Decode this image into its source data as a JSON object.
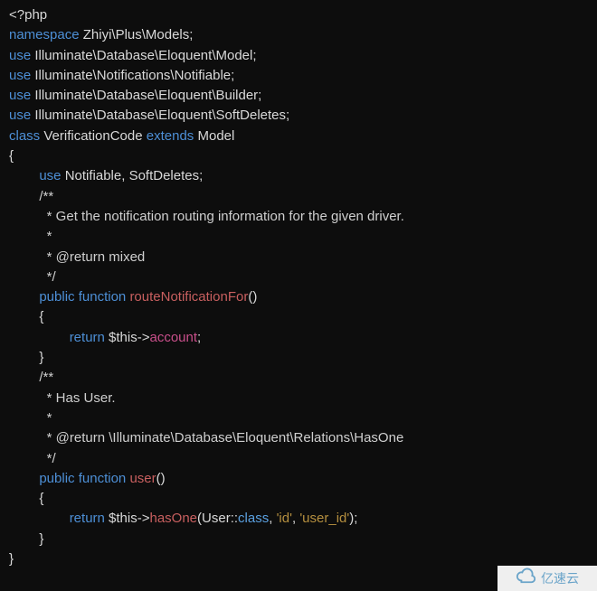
{
  "l0_open": "<?php",
  "l1_kw": "namespace",
  "l1_rest": " Zhiyi\\Plus\\Models;",
  "l2_kw": "use",
  "l2_rest": " Illuminate\\Database\\Eloquent\\Model;",
  "l3_kw": "use",
  "l3_rest": " Illuminate\\Notifications\\Notifiable;",
  "l4_kw": "use",
  "l4_rest": " Illuminate\\Database\\Eloquent\\Builder;",
  "l5_kw": "use",
  "l5_rest": " Illuminate\\Database\\Eloquent\\SoftDeletes;",
  "l6_kw1": "class",
  "l6_name": " VerificationCode ",
  "l6_kw2": "extends",
  "l6_rest": " Model",
  "l7": "{",
  "l8_pad": "        ",
  "l8_kw": "use",
  "l8_rest": " Notifiable, SoftDeletes;",
  "l9": "        /**",
  "l10": "          * Get the notification routing information for the given driver.",
  "l11": "          *",
  "l12": "          * @return mixed",
  "l13": "          */",
  "l14_pad": "        ",
  "l14_kw1": "public",
  "l14_sp1": " ",
  "l14_kw2": "function",
  "l14_sp2": " ",
  "l14_fn": "routeNotificationFor",
  "l14_rest": "()",
  "l15": "        {",
  "l16_pad": "                ",
  "l16_kw": "return",
  "l16_mid": " $this->",
  "l16_mem": "account",
  "l16_end": ";",
  "l17": "        }",
  "l18": "",
  "l19": "        /**",
  "l20": "          * Has User.",
  "l21": "          *",
  "l22": "          * @return \\Illuminate\\Database\\Eloquent\\Relations\\HasOne",
  "l23": "          */",
  "l24_pad": "        ",
  "l24_kw1": "public",
  "l24_sp1": " ",
  "l24_kw2": "function",
  "l24_sp2": " ",
  "l24_fn": "user",
  "l24_rest": "()",
  "l25": "        {",
  "l26_pad": "                ",
  "l26_kw": "return",
  "l26_a": " $this->",
  "l26_mem": "hasOne",
  "l26_b": "(User::",
  "l26_cls": "class",
  "l26_c": ", ",
  "l26_s1": "'id'",
  "l26_d": ", ",
  "l26_s2": "'user_id'",
  "l26_e": ");",
  "l27": "        }",
  "l28": "}",
  "watermark_text": "亿速云"
}
